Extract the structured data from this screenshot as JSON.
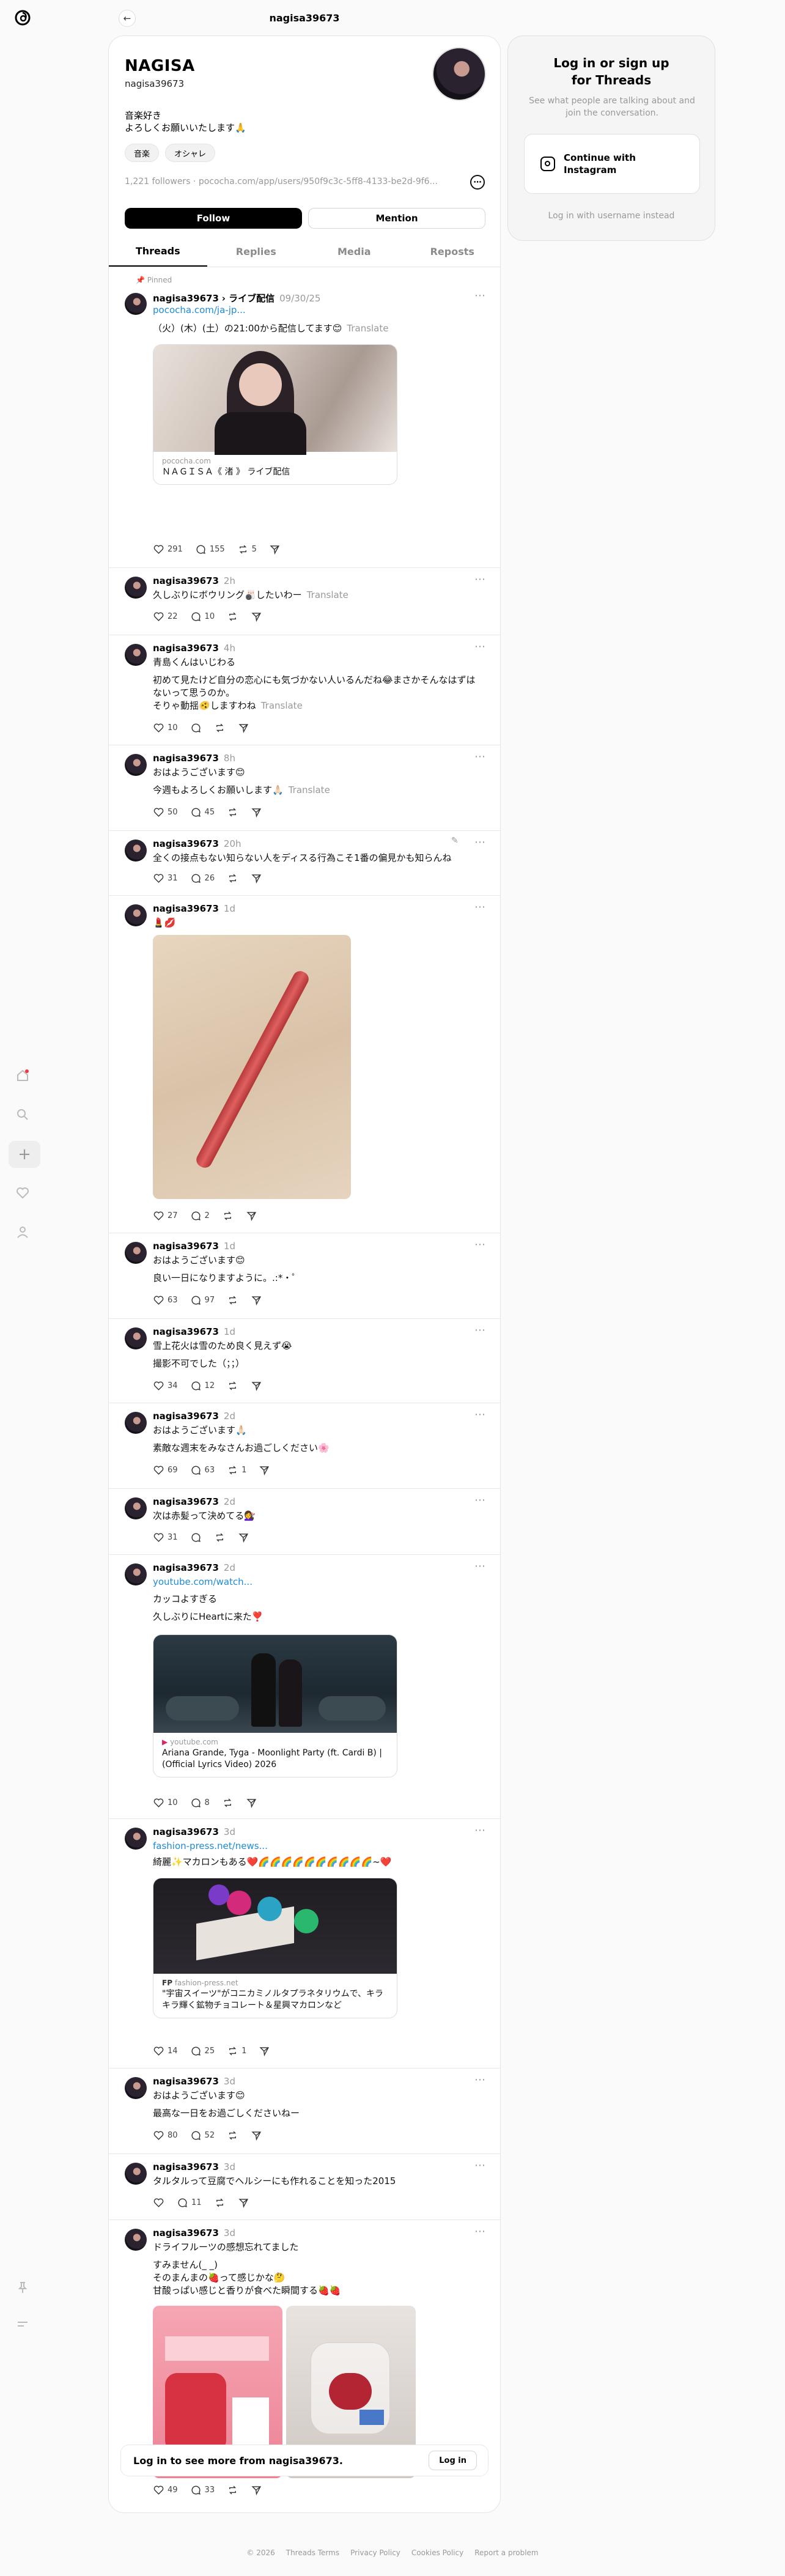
{
  "topbar": {
    "title": "nagisa39673"
  },
  "profile": {
    "name": "NAGISA",
    "handle": "nagisa39673",
    "bio1": "音楽好き",
    "bio2": "よろしくお願いいたします🙏",
    "tags": [
      "音楽",
      "オシャレ"
    ],
    "meta": "1,221 followers · pococha.com/app/users/950f9c3c-5ff8-4133-be2d-9f6...",
    "follow_label": "Follow",
    "mention_label": "Mention"
  },
  "tabs": [
    "Threads",
    "Replies",
    "Media",
    "Reposts"
  ],
  "pinned_label": "Pinned",
  "posts": [
    {
      "user": "nagisa39673",
      "extra": "› ライブ配信",
      "time": "09/30/25",
      "link": "pococha.com/ja-jp...",
      "text": "（火）(木）(土）の21:00から配信してます😊",
      "translate": "Translate",
      "card_domain": "pococha.com",
      "card_title": "ＮＡＧＩＳＡ《 渚 》 ライブ配信",
      "likes": "291",
      "replies": "155",
      "reposts": "5"
    },
    {
      "user": "nagisa39673",
      "time": "2h",
      "text": "久しぶりにボウリング🎳したいわー",
      "translate": "Translate",
      "likes": "22",
      "replies": "10"
    },
    {
      "user": "nagisa39673",
      "time": "4h",
      "text1": "青島くんはいじわる",
      "text2": "初めて見たけど自分の恋心にも気づかない人いるんだね😂まさかそんなはずはないって思うのか。",
      "text3": "そりゃ動揺🫨しますわね",
      "translate": "Translate",
      "likes": "10"
    },
    {
      "user": "nagisa39673",
      "time": "8h",
      "text1": "おはようございます😊",
      "text2": "今週もよろしくお願いします🙏🏻",
      "translate": "Translate",
      "likes": "50",
      "replies": "45"
    },
    {
      "user": "nagisa39673",
      "time": "20h",
      "text": "全くの接点もない知らない人をディスる行為こそ1番の偏見かも知らんね",
      "likes": "31",
      "replies": "26"
    },
    {
      "user": "nagisa39673",
      "time": "1d",
      "text": "💄💋",
      "likes": "27",
      "replies": "2"
    },
    {
      "user": "nagisa39673",
      "time": "1d",
      "text1": "おはようございます😊",
      "text2": "良い一日になりますように。.:*・゜",
      "likes": "63",
      "replies": "97"
    },
    {
      "user": "nagisa39673",
      "time": "1d",
      "text1": "雪上花火は雪のため良く見えず😭",
      "text2": "撮影不可でした（；；）",
      "likes": "34",
      "replies": "12"
    },
    {
      "user": "nagisa39673",
      "time": "2d",
      "text1": "おはようございます🙏🏻",
      "text2": "素敵な週末をみなさんお過ごしください🌸",
      "likes": "69",
      "replies": "63",
      "reposts": "1"
    },
    {
      "user": "nagisa39673",
      "time": "2d",
      "text": "次は赤髪って決めてる💇‍♀️",
      "likes": "31"
    },
    {
      "user": "nagisa39673",
      "time": "2d",
      "link": "youtube.com/watch...",
      "text1": "カッコよすぎる",
      "text2": "久しぶりにHeartに来た❣️",
      "card_domain": "youtube.com",
      "card_title": "Ariana Grande, Tyga - Moonlight Party (ft. Cardi B) | (Official Lyrics Video) 2026",
      "likes": "10",
      "replies": "8"
    },
    {
      "user": "nagisa39673",
      "time": "3d",
      "link": "fashion-press.net/news...",
      "text": "綺麗✨マカロンもある❤️🌈🌈🌈🌈🌈🌈🌈🌈🌈🌈~❤️",
      "card_domain": "fashion-press.net",
      "card_title": "\"宇宙スイーツ\"がコニカミノルタプラネタリウムで、キラキラ輝く鉱物チョコレート＆星興マカロンなど",
      "likes": "14",
      "replies": "25",
      "reposts": "1"
    },
    {
      "user": "nagisa39673",
      "time": "3d",
      "text1": "おはようございます😊",
      "text2": "最高な一日をお過ごしくださいねー",
      "likes": "80",
      "replies": "52"
    },
    {
      "user": "nagisa39673",
      "time": "3d",
      "text": "タルタルって豆腐でヘルシーにも作れることを知った2015",
      "replies": "11"
    },
    {
      "user": "nagisa39673",
      "time": "3d",
      "text1": "ドライフルーツの感想忘れてました",
      "text2": "すみません(_ _)",
      "text3": "そのまんまの🍓って感じかな🤔",
      "text4": "甘酸っぱい感じと香りが食べた瞬間する🍓🍓",
      "likes": "49",
      "replies": "33"
    }
  ],
  "login_panel": {
    "title": "Log in or sign up for Threads",
    "subtitle": "See what people are talking about and join the conversation.",
    "instagram_label": "Continue with Instagram",
    "alt_label": "Log in with username instead"
  },
  "see_more": {
    "text": "Log in to see more from nagisa39673.",
    "button": "Log in"
  },
  "footer": [
    "© 2026",
    "Threads Terms",
    "Privacy Policy",
    "Cookies Policy",
    "Report a problem"
  ]
}
